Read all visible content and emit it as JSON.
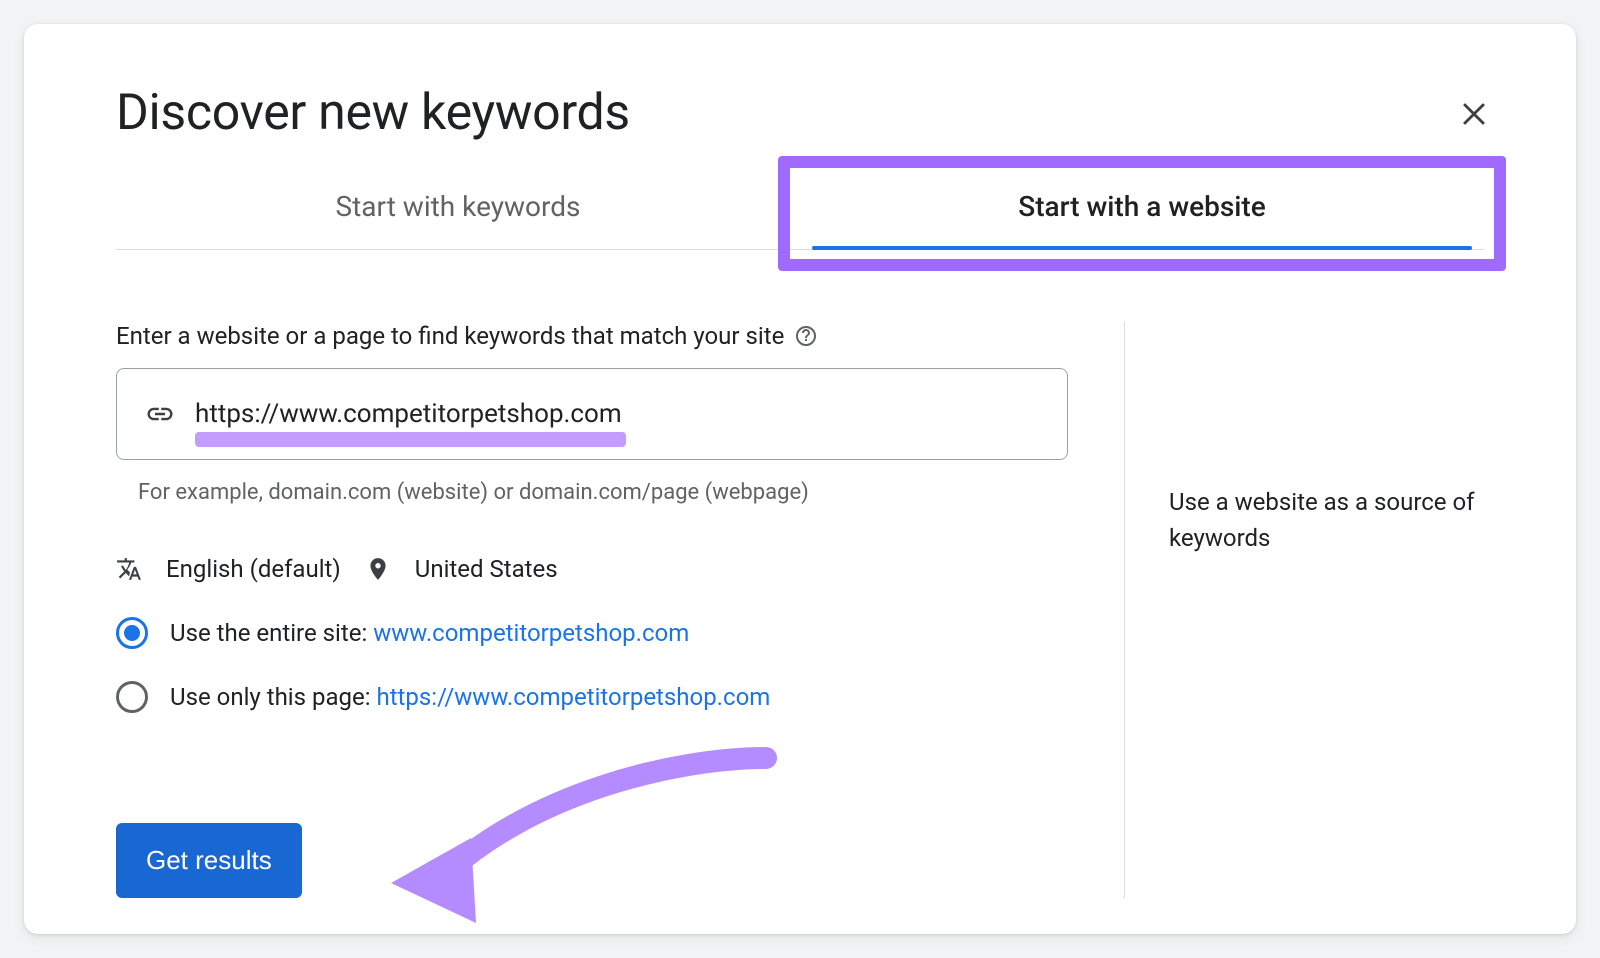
{
  "header": {
    "title": "Discover new keywords"
  },
  "tabs": {
    "keywords": "Start with keywords",
    "website": "Start with a website"
  },
  "form": {
    "label": "Enter a website or a page to find keywords that match your site",
    "url_value": "https://www.competitorpetshop.com",
    "example": "For example, domain.com (website) or domain.com/page (webpage)"
  },
  "settings": {
    "language": "English (default)",
    "location": "United States"
  },
  "scope": {
    "entire_label": "Use the entire site: ",
    "entire_link": "www.competitorpetshop.com",
    "page_label": "Use only this page: ",
    "page_link": "https://www.competitorpetshop.com"
  },
  "hint": "Use a website as a source of keywords",
  "cta": "Get results"
}
